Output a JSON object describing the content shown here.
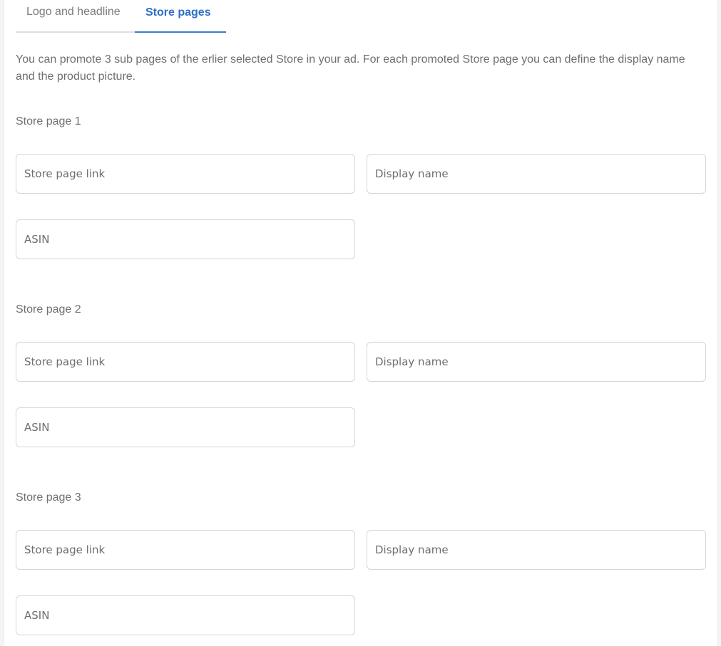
{
  "tabs": [
    {
      "label": "Logo and headline",
      "active": false
    },
    {
      "label": "Store pages",
      "active": true
    }
  ],
  "description": "You can promote 3 sub pages of the erlier selected Store in your ad. For each promoted Store page you can define the display name and the product picture.",
  "store_pages": [
    {
      "title": "Store page 1",
      "link_placeholder": "Store page link",
      "display_name_placeholder": "Display name",
      "asin_placeholder": "ASIN",
      "link_value": "",
      "display_name_value": "",
      "asin_value": ""
    },
    {
      "title": "Store page 2",
      "link_placeholder": "Store page link",
      "display_name_placeholder": "Display name",
      "asin_placeholder": "ASIN",
      "link_value": "",
      "display_name_value": "",
      "asin_value": ""
    },
    {
      "title": "Store page 3",
      "link_placeholder": "Store page link",
      "display_name_placeholder": "Display name",
      "asin_placeholder": "ASIN",
      "link_value": "",
      "display_name_value": "",
      "asin_value": ""
    }
  ],
  "colors": {
    "accent": "#2f6fc4",
    "border": "#d6d6d6",
    "text_muted": "#707070"
  }
}
